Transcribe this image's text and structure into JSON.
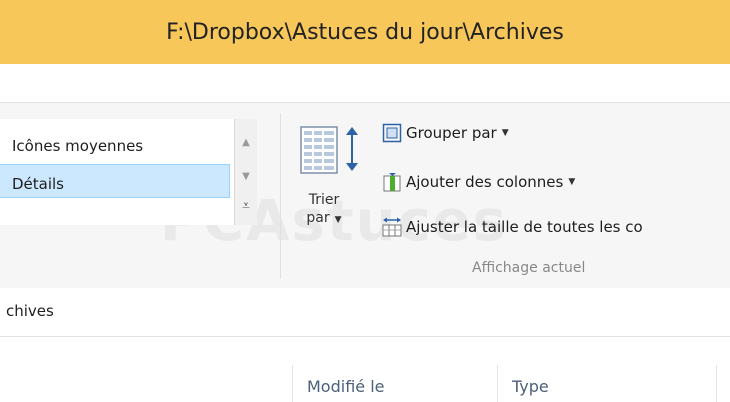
{
  "window": {
    "title": "F:\\Dropbox\\Astuces du jour\\Archives"
  },
  "ribbon": {
    "layout": {
      "items": [
        {
          "label": "Icônes moyennes"
        },
        {
          "label": "Détails",
          "selected": true
        },
        {
          "label": ""
        }
      ]
    },
    "sort": {
      "label_line1": "Trier",
      "label_line2": "par"
    },
    "commands": [
      {
        "label": "Grouper par",
        "icon": "group-by-icon",
        "dropdown": true
      },
      {
        "label": "Ajouter des colonnes",
        "icon": "add-columns-icon",
        "dropdown": true
      },
      {
        "label": "Ajuster la taille de toutes les co",
        "icon": "size-columns-icon",
        "dropdown": false
      }
    ],
    "group_label": "Affichage actuel",
    "watermark": "PCAstuces"
  },
  "address": {
    "path": "chives"
  },
  "columns": [
    {
      "label": "Modifié le"
    },
    {
      "label": "Type"
    }
  ],
  "colors": {
    "titlebar": "#f7c75a",
    "selection": "#cce8ff",
    "selection_border": "#99d1ff",
    "column_header_text": "#4c607a"
  }
}
